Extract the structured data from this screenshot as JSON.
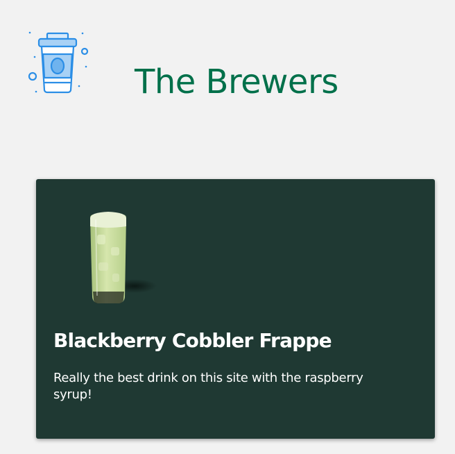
{
  "header": {
    "logo_icon": "coffee-cup-icon",
    "title": "The Brewers"
  },
  "drinks": [
    {
      "name": "Blackberry Cobbler Frappe",
      "description": "Really the best drink on this site with the raspberry syrup!",
      "image_icon": "iced-matcha-drink-icon"
    }
  ],
  "colors": {
    "page_background": "#f2f2f2",
    "title_green": "#00704a",
    "card_background": "#1f3933",
    "card_text": "#ffffff",
    "logo_blue": "#2b8ee6",
    "logo_fill": "#a8d1f5"
  }
}
